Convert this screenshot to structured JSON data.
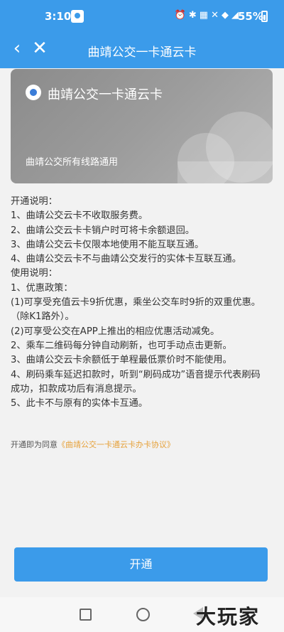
{
  "status_bar": {
    "time": "3:10",
    "battery": "55%",
    "icons": [
      "alarm-icon",
      "bluetooth-icon",
      "volte-icon",
      "mute-icon",
      "wifi-icon",
      "signal-4g-icon",
      "battery-icon"
    ]
  },
  "nav": {
    "title": "曲靖公交一卡通云卡"
  },
  "card": {
    "name": "曲靖公交一卡通云卡",
    "description": "曲靖公交所有线路通用"
  },
  "instructions": [
    "开通说明：",
    "1、曲靖公交云卡不收取服务费。",
    "2、曲靖公交云卡卡销户时可将卡余额退回。",
    "3、曲靖公交云卡仅限本地使用不能互联互通。",
    "4、曲靖公交云卡不与曲靖公交发行的实体卡互联互通。",
    "使用说明：",
    "1、优惠政策：",
    "(1)可享受充值云卡9折优惠，乘坐公交车时9折的双重优惠。",
    "（除K1路外）。",
    "(2)可享受公交在APP上推出的相应优惠活动减免。",
    "2、乘车二维码每分钟自动刷新，也可手动点击更新。",
    "3、曲靖公交云卡余额低于单程最低票价时不能使用。",
    "4、刷码乘车延迟扣款时，听到“刷码成功”语音提示代表刷码",
    "成功，扣款成功后有消息提示。",
    "5、此卡不与原有的实体卡互通。"
  ],
  "agreement": {
    "prefix": "开通即为同意",
    "link": "《曲靖公交一卡通云卡办卡协议》"
  },
  "open_button": "开通",
  "watermark": "大玩家",
  "colors": {
    "primary": "#3b9bea",
    "link": "#e6a23c"
  }
}
